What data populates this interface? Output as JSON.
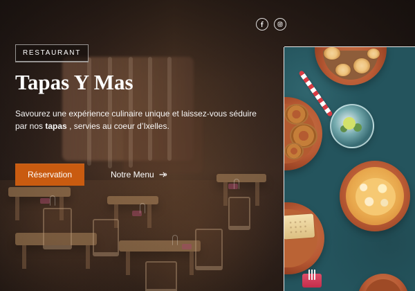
{
  "badge": {
    "label": "RESTAURANT"
  },
  "hero": {
    "title": "Tapas Y Mas",
    "description_before": "Savourez une expérience culinaire unique et laissez-vous séduire par nos ",
    "description_bold": "tapas",
    "description_after": ", servies au coeur d’Ixelles."
  },
  "actions": {
    "reservation_label": "Réservation",
    "menu_label": "Notre Menu"
  },
  "social": {
    "facebook_label": "f",
    "instagram_label": "◎"
  },
  "icons": {
    "menu_arrow": "arrow-right-icon",
    "facebook": "facebook-icon",
    "instagram": "instagram-icon"
  },
  "colors": {
    "accent": "#c95b10",
    "text": "#ffffff",
    "panel_bg": "#24545d"
  }
}
